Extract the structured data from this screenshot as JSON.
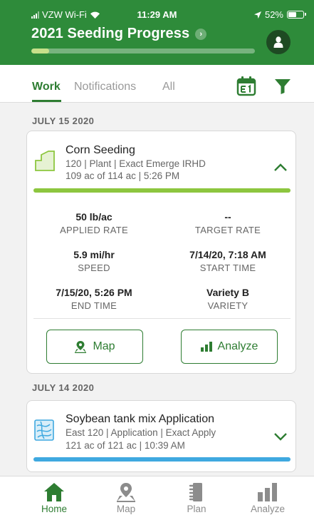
{
  "status_bar": {
    "carrier": "VZW Wi-Fi",
    "time": "11:29 AM",
    "battery": "52%"
  },
  "header": {
    "title": "2021 Seeding Progress",
    "progress_fraction": 0.08
  },
  "tabs": [
    {
      "label": "Work",
      "active": true
    },
    {
      "label": "Notifications",
      "active": false
    },
    {
      "label": "All",
      "active": false
    }
  ],
  "sections": [
    {
      "date": "JULY 15 2020",
      "card": {
        "name": "Corn Seeding",
        "line1": "120 | Plant | Exact Emerge IRHD",
        "line2": "109 ac of 114 ac | 5:26 PM",
        "bar_color": "#8dc63f",
        "progress_fraction": 1.0,
        "stats": [
          {
            "value": "50 lb/ac",
            "label": "APPLIED RATE"
          },
          {
            "value": "--",
            "label": "TARGET RATE"
          },
          {
            "value": "5.9 mi/hr",
            "label": "SPEED"
          },
          {
            "value": "7/14/20, 7:18 AM",
            "label": "START TIME"
          },
          {
            "value": "7/15/20, 5:26 PM",
            "label": "END TIME"
          },
          {
            "value": "Variety B",
            "label": "VARIETY"
          }
        ],
        "map_label": "Map",
        "analyze_label": "Analyze"
      }
    },
    {
      "date": "JULY 14 2020",
      "card": {
        "name": "Soybean tank mix Application",
        "line1": "East 120 | Application | Exact Apply",
        "line2": "121 ac of 121 ac | 10:39 AM",
        "bar_color": "#3fa9e0",
        "progress_fraction": 1.0
      }
    }
  ],
  "bottom_nav": [
    {
      "label": "Home",
      "icon": "home-icon",
      "active": true
    },
    {
      "label": "Map",
      "icon": "map-pin-icon",
      "active": false
    },
    {
      "label": "Plan",
      "icon": "plan-icon",
      "active": false
    },
    {
      "label": "Analyze",
      "icon": "analyze-icon",
      "active": false
    }
  ],
  "colors": {
    "brand_green": "#2e8b3a",
    "accent_green": "#2e7d32"
  }
}
